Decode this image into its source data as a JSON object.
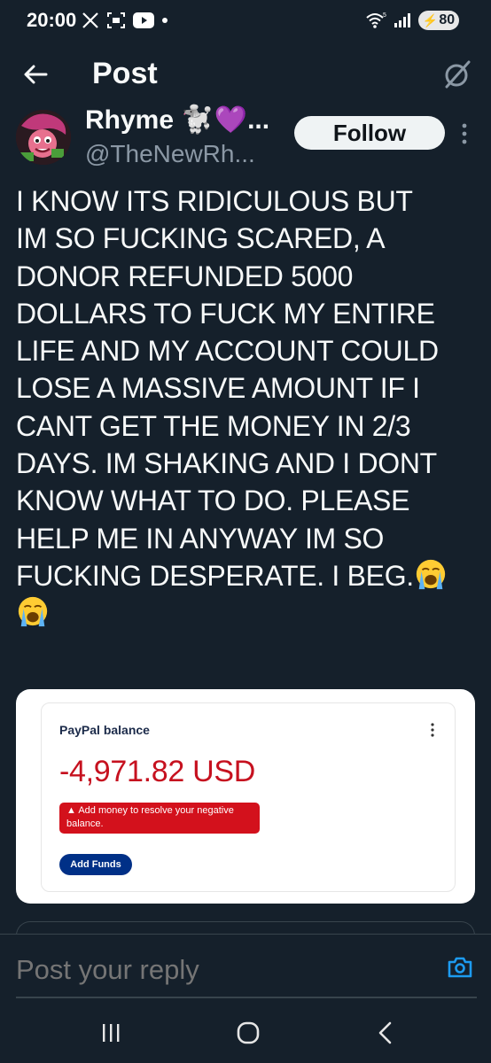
{
  "status_bar": {
    "time": "20:00",
    "battery": "80",
    "icons_left": [
      "x-logo-icon",
      "screenshot-icon",
      "youtube-icon",
      "dot-icon"
    ],
    "icons_right": [
      "wifi-icon",
      "signal-icon",
      "battery-icon"
    ]
  },
  "header": {
    "title": "Post",
    "back_icon": "arrow-left-icon",
    "grok_icon": "grok-icon"
  },
  "author": {
    "display_name": "Rhyme 🐩💜...",
    "handle": "@TheNewRh...",
    "follow_label": "Follow",
    "more_icon": "more-vertical-icon"
  },
  "tweet": {
    "text": "I KNOW ITS RIDICULOUS BUT\nIM SO FUCKING SCARED, A\nDONOR REFUNDED 5000\nDOLLARS TO FUCK MY ENTIRE\nLIFE AND MY ACCOUNT COULD\nLOSE A MASSIVE AMOUNT IF I\nCANT GET THE MONEY IN 2/3\nDAYS. IM SHAKING AND I DONT\nKNOW WHAT TO DO. PLEASE\nHELP ME IN ANYWAY IM SO\nFUCKING DESPERATE. I BEG.",
    "emoji_count": 2,
    "emoji_icon": "loudly-crying-face-icon"
  },
  "media": {
    "card_title": "PayPal balance",
    "amount": "-4,971.82 USD",
    "alert_text": "Add money to resolve your negative balance.",
    "button_label": "Add Funds",
    "colors": {
      "amount": "#c6111f",
      "alert_bg": "#d3111c",
      "button_bg": "#003087"
    }
  },
  "reply": {
    "placeholder": "Post your reply",
    "camera_icon": "camera-icon"
  },
  "nav": {
    "icons": [
      "recents-icon",
      "home-icon",
      "back-icon"
    ]
  },
  "colors": {
    "background": "#15202b",
    "text": "#f7f9f9",
    "secondary_text": "#8b98a5",
    "accent": "#1d9bf0"
  }
}
